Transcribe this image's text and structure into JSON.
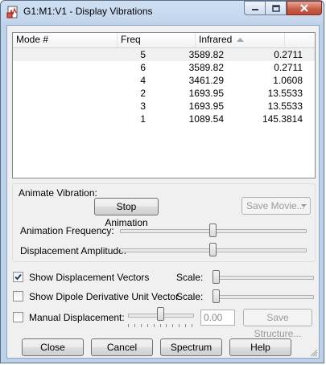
{
  "window": {
    "title": "G1:M1:V1 - Display Vibrations",
    "icon": "document-chart-icon",
    "caption_buttons": [
      "minimize-icon",
      "maximize-icon",
      "close-icon"
    ]
  },
  "modes_table": {
    "columns": [
      "Mode #",
      "Freq",
      "Infrared"
    ],
    "sort_column": "Infrared",
    "rows": [
      {
        "mode": "5",
        "freq": "3589.82",
        "infrared": "0.2711"
      },
      {
        "mode": "6",
        "freq": "3589.82",
        "infrared": "0.2711"
      },
      {
        "mode": "4",
        "freq": "3461.29",
        "infrared": "1.0608"
      },
      {
        "mode": "2",
        "freq": "1693.95",
        "infrared": "13.5533"
      },
      {
        "mode": "3",
        "freq": "1693.95",
        "infrared": "13.5533"
      },
      {
        "mode": "1",
        "freq": "1089.54",
        "infrared": "145.3814"
      }
    ],
    "selected_row": 0
  },
  "animate": {
    "group_label": "Animate Vibration:",
    "stop_button": "Stop Animation",
    "save_movie_button": "Save Movie...",
    "frequency_label": "Animation Frequency:",
    "frequency_level": 0.5,
    "amplitude_label": "Displacement Amplitude:",
    "amplitude_level": 0.5
  },
  "options": {
    "show_displacement_vectors": {
      "label": "Show Displacement Vectors",
      "checked": true,
      "scale_label": "Scale:",
      "scale_level": 0.0
    },
    "show_dipole_vector": {
      "label": "Show Dipole Derivative Unit Vector",
      "checked": false,
      "scale_label": "Scale:",
      "scale_level": 0.0
    },
    "manual_displacement": {
      "label": "Manual Displacement:",
      "checked": false,
      "value": "0.00",
      "level": 0.5
    },
    "save_structure_button": "Save Structure..."
  },
  "footer": {
    "close": "Close",
    "cancel": "Cancel",
    "spectrum": "Spectrum",
    "help": "Help"
  },
  "colors": {
    "titlebar": "#c3d6ec",
    "client_bg": "#f0f0f0",
    "close_button": "#c75a43",
    "check_mark": "#1e3f73"
  }
}
